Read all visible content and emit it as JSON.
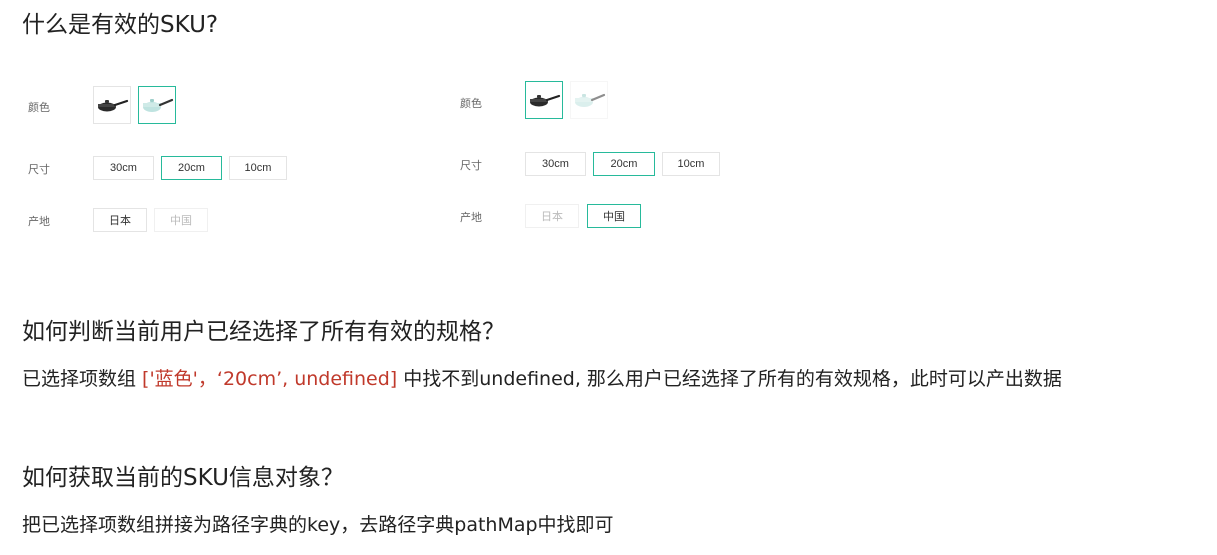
{
  "headings": {
    "h1": "什么是有效的SKU?",
    "h2": "如何判断当前用户已经选择了所有有效的规格？",
    "h3": "如何获取当前的SKU信息对象？"
  },
  "para1": {
    "before": "已选择项数组 ",
    "highlight": "['蓝色'，‘20cm’, undefined]",
    "after": " 中找不到undefined, 那么用户已经选择了所有的有效规格，此时可以产出数据"
  },
  "para2": "把已选择项数组拼接为路径字典的key，去路径字典pathMap中找即可",
  "panel_left": {
    "color_label": "颜色",
    "size_label": "尺寸",
    "origin_label": "产地",
    "colors": [
      {
        "icon": "black-pan-icon",
        "state": "normal"
      },
      {
        "icon": "blue-pan-icon",
        "state": "selected"
      }
    ],
    "sizes": [
      {
        "label": "30cm",
        "state": "normal"
      },
      {
        "label": "20cm",
        "state": "selected"
      },
      {
        "label": "10cm",
        "state": "normal"
      }
    ],
    "origins": [
      {
        "label": "日本",
        "state": "normal"
      },
      {
        "label": "中国",
        "state": "disabled"
      }
    ]
  },
  "panel_right": {
    "color_label": "颜色",
    "size_label": "尺寸",
    "origin_label": "产地",
    "colors": [
      {
        "icon": "black-pan-icon",
        "state": "selected"
      },
      {
        "icon": "blue-pan-icon",
        "state": "disabled"
      }
    ],
    "sizes": [
      {
        "label": "30cm",
        "state": "normal"
      },
      {
        "label": "20cm",
        "state": "selected"
      },
      {
        "label": "10cm",
        "state": "normal"
      }
    ],
    "origins": [
      {
        "label": "日本",
        "state": "disabled"
      },
      {
        "label": "中国",
        "state": "selected"
      }
    ]
  },
  "colors": {
    "accent": "#27ba9b",
    "highlight_text": "#c0392b",
    "pan_black": "#2a2a2a",
    "pan_blue": "#bfe3e0"
  }
}
